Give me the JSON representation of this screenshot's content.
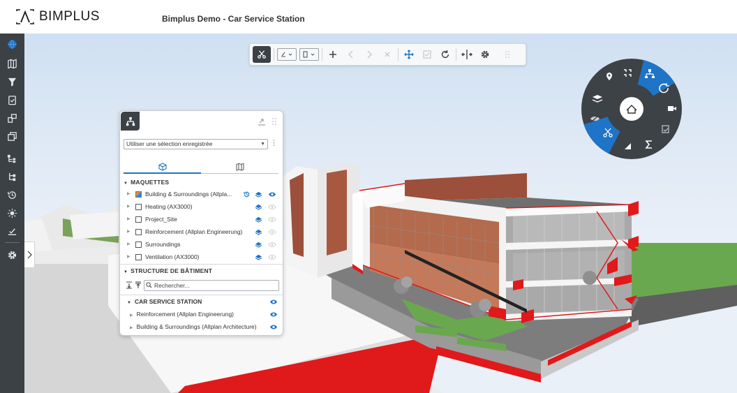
{
  "header": {
    "logo_text": "BIMPLUS",
    "project_title": "Bimplus Demo  - Car Service Station"
  },
  "sidebar": {
    "items": [
      {
        "icon": "globe-icon"
      },
      {
        "icon": "map-icon"
      },
      {
        "icon": "filter-icon"
      },
      {
        "icon": "clipboard-check-icon"
      },
      {
        "icon": "link-objects-icon"
      },
      {
        "icon": "copy-objects-icon"
      },
      {
        "icon": "hierarchy-icon"
      },
      {
        "icon": "structure-icon"
      },
      {
        "icon": "history-icon"
      },
      {
        "icon": "light-icon"
      },
      {
        "icon": "task-icon"
      },
      {
        "icon": "settings-icon"
      }
    ],
    "active_color": "#1e74c6"
  },
  "toolbar": {
    "items": [
      "scissors-icon",
      "markup-dropdown",
      "section-dropdown",
      "plus-icon",
      "prev-icon",
      "next-icon",
      "close-icon",
      "move-icon",
      "checkbox-icon",
      "rotate-icon",
      "split-icon",
      "gear-icon",
      "grip-icon"
    ]
  },
  "radial_menu": {
    "center_icon": "home-icon",
    "items": [
      "frame-icon",
      "hierarchy-icon",
      "refresh-icon",
      "camera-icon",
      "checklist-icon",
      "sum-icon",
      "measure-icon",
      "scissors-icon",
      "hide-icon",
      "layers-icon",
      "pin-icon"
    ],
    "active_items": [
      "hierarchy-icon",
      "scissors-icon"
    ]
  },
  "panel": {
    "selection_select": "Utiliser une sélection enregistrée",
    "tab_models_icon": "cube-icon",
    "tab_map_icon": "map-icon",
    "section_models": "MAQUETTES",
    "models": [
      {
        "label": "Building & Surroundings (Allpla...",
        "checked": true,
        "visible": true,
        "has_history": true
      },
      {
        "label": "Heating (AX3000)",
        "checked": false,
        "visible": false
      },
      {
        "label": "Project_Site",
        "checked": false,
        "visible": false
      },
      {
        "label": "Reinforcement (Allplan Engineerung)",
        "checked": false,
        "visible": false
      },
      {
        "label": "Surroundings",
        "checked": false,
        "visible": false
      },
      {
        "label": "Ventilation (AX3000)",
        "checked": false,
        "visible": false
      }
    ],
    "section_structure": "STRUCTURE DE BÂTIMENT",
    "search_placeholder": "Rechercher...",
    "tree": {
      "root": "CAR SERVICE STATION",
      "children": [
        "Reinforcement (Allplan Engineerung)",
        "Building & Surroundings (Allplan Architecture)"
      ]
    }
  },
  "colors": {
    "accent": "#1e74c6",
    "sidebar_bg": "#3c4146",
    "highlight_red": "#e0191b"
  }
}
